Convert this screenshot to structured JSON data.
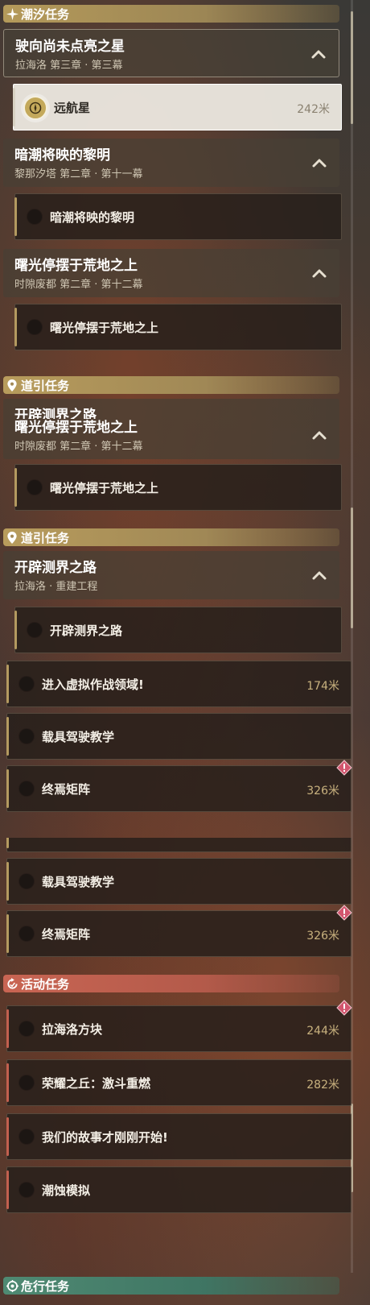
{
  "sections": {
    "tide": "潮汐任务",
    "guide": "道引任务",
    "event": "活动任务",
    "danger": "危行任务"
  },
  "chapters": {
    "c1": {
      "title": "驶向尚未点亮之星",
      "subtitle": "拉海洛 第三章 · 第三幕"
    },
    "c2": {
      "title": "暗潮将映的黎明",
      "subtitle": "黎那汐塔 第二章 · 第十一幕"
    },
    "c3": {
      "title": "曙光停摆于荒地之上",
      "subtitle": "时隙废都 第二章 · 第十二幕"
    },
    "c4": {
      "title": "开辟测界之路",
      "subtitle": "拉海洛 · 重建工程"
    }
  },
  "quests": {
    "yuanhang": {
      "name": "远航星",
      "distance": "242米"
    },
    "anchao": {
      "name": "暗潮将映的黎明"
    },
    "shuguang": {
      "name": "曙光停摆于荒地之上"
    },
    "kaipi": {
      "name": "开辟测界之路"
    },
    "xuni": {
      "name": "进入虚拟作战领域!",
      "distance": "174米"
    },
    "zaiju": {
      "name": "载具驾驶教学"
    },
    "zhongyan": {
      "name": "终焉矩阵",
      "distance": "326米"
    },
    "fangkuai": {
      "name": "拉海洛方块",
      "distance": "244米"
    },
    "rongyao": {
      "name": "荣耀之丘：激斗重燃",
      "distance": "282米"
    },
    "gushi": {
      "name": "我们的故事才刚刚开始!"
    },
    "chaoshi": {
      "name": "潮蚀模拟"
    }
  },
  "colors": {
    "tide_header": "#b59a5a",
    "event_header": "#c96553",
    "danger_header": "#4f8a73",
    "distance_text": "#c9b27f",
    "warning_badge": "#d2566e"
  },
  "icons": {
    "tide": "sparkle-icon",
    "guide": "map-pin-icon",
    "event": "refresh-icon",
    "danger": "radar-icon",
    "expand": "chevron-up-icon",
    "tracked": "compass-icon",
    "warning": "warning-diamond-icon"
  }
}
